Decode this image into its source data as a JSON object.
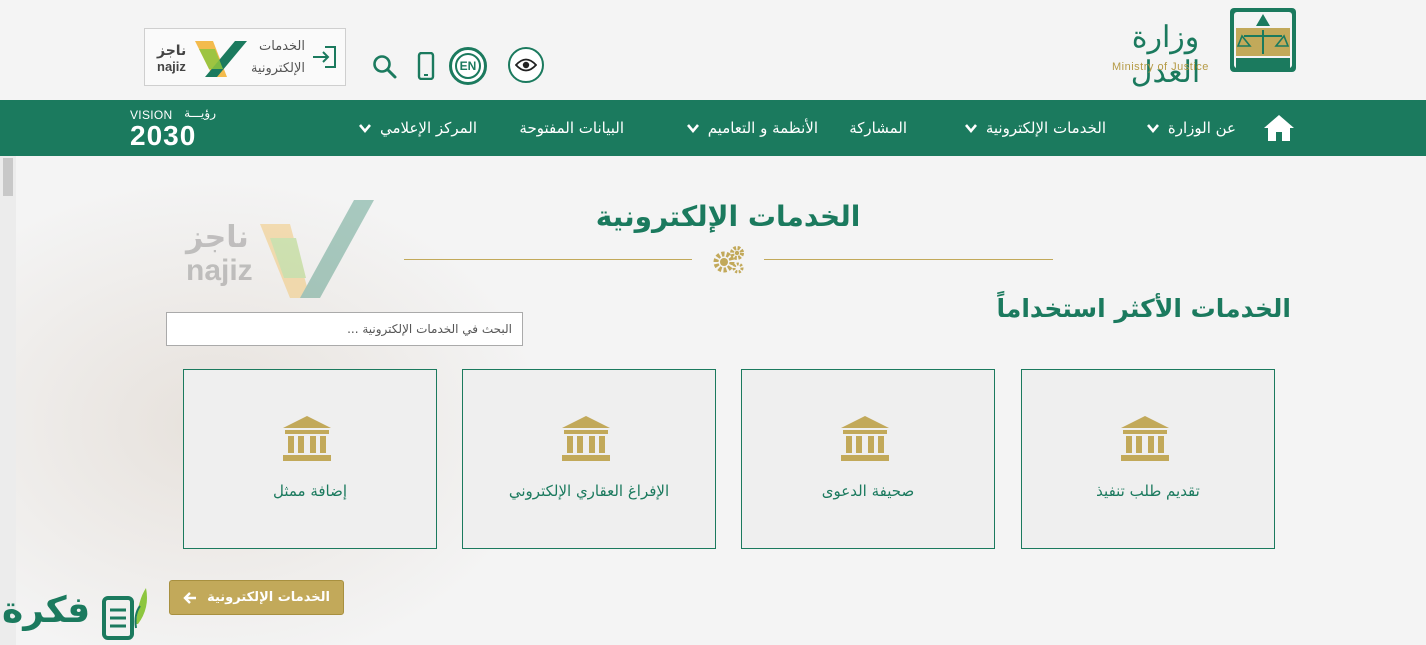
{
  "header": {
    "najiz": {
      "logo_ar": "ناجز",
      "logo_en": "najiz",
      "label_line1": "الخدمات",
      "label_line2": "الإلكترونية"
    },
    "language_toggle": "EN",
    "ministry_name_ar": "وزارة العدل",
    "ministry_name_en": "Ministry of Justice"
  },
  "nav": {
    "vision_label": "VISION",
    "vision_ar": "رؤيـــة",
    "vision_year": "2030",
    "items": [
      {
        "label": "عن الوزارة"
      },
      {
        "label": "الخدمات الإلكترونية"
      },
      {
        "label": "المشاركة"
      },
      {
        "label": "الأنظمة و التعاميم"
      },
      {
        "label": "البيانات المفتوحة"
      },
      {
        "label": "المركز الإعلامي"
      }
    ]
  },
  "watermark": {
    "ar": "ناجز",
    "en": "najiz"
  },
  "main": {
    "page_title": "الخدمات الإلكترونية",
    "section_title": "الخدمات الأكثر استخداماً",
    "search_placeholder": "البحث في الخدمات الإلكترونية ...",
    "cards": [
      {
        "label": "تقديم طلب تنفيذ"
      },
      {
        "label": "صحيفة الدعوى"
      },
      {
        "label": "الإفراغ العقاري الإلكتروني"
      },
      {
        "label": "إضافة ممثل"
      }
    ],
    "eservices_button": "الخدمات الإلكترونية"
  },
  "fikra_logo": "فكرة",
  "colors": {
    "primary_green": "#1b7a5e",
    "gold": "#c2a95a",
    "background": "#f4f4f4"
  },
  "icons": [
    "home-icon",
    "chevron-down-icon",
    "search-icon",
    "mobile-icon",
    "eye-icon",
    "enter-icon",
    "gears-icon",
    "bank-icon",
    "arrow-left-icon"
  ]
}
